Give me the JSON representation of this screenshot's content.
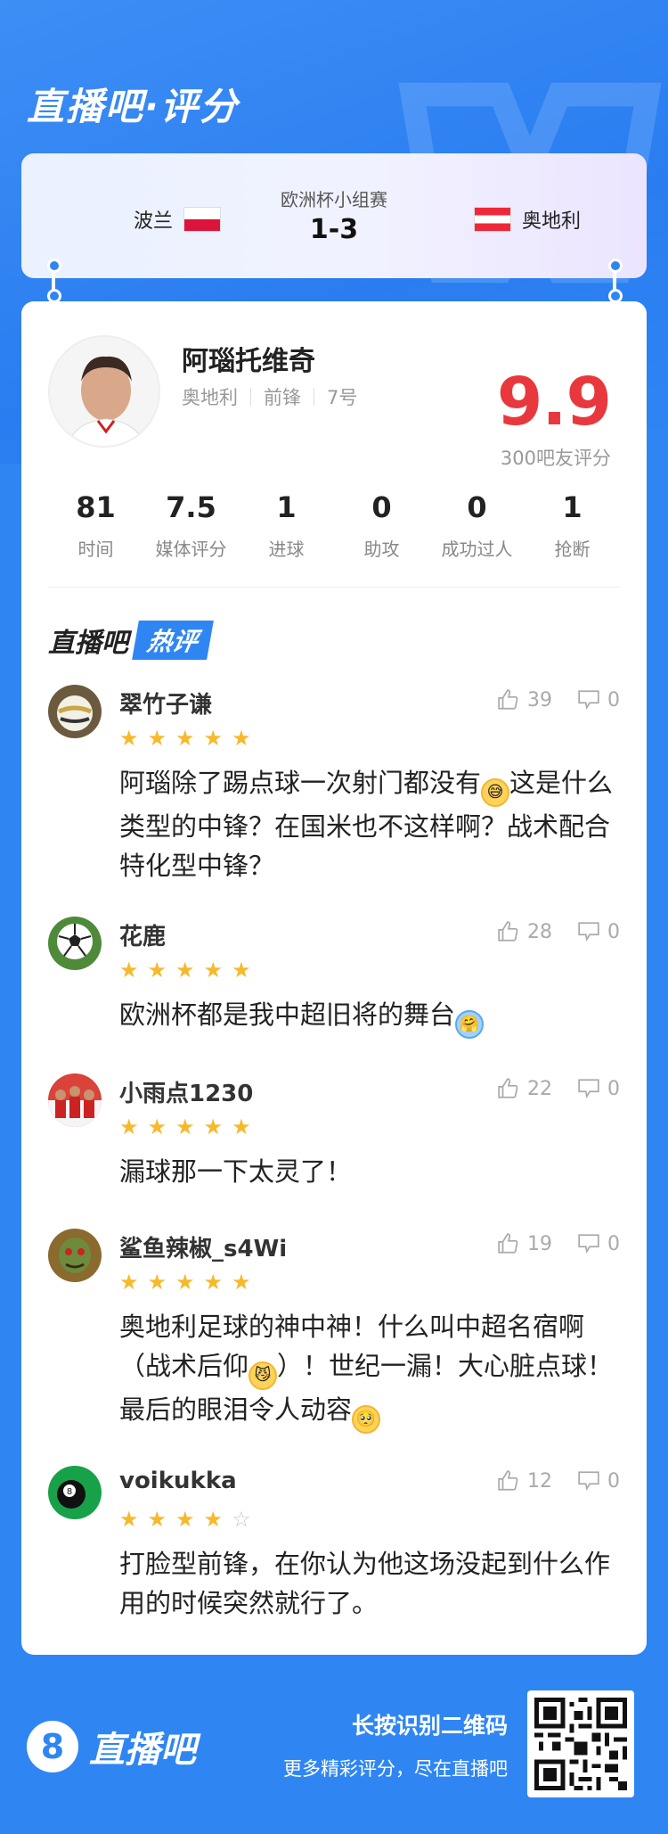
{
  "header": {
    "title": "直播吧·评分"
  },
  "match": {
    "competition": "欧洲杯小组赛",
    "score": "1-3",
    "home_team": "波兰",
    "away_team": "奥地利"
  },
  "player": {
    "name": "阿瑙托维奇",
    "team": "奥地利",
    "position": "前锋",
    "number": "7号",
    "rating": "9.9",
    "rating_label": "300吧友评分"
  },
  "stats": [
    {
      "value": "81",
      "label": "时间"
    },
    {
      "value": "7.5",
      "label": "媒体评分"
    },
    {
      "value": "1",
      "label": "进球"
    },
    {
      "value": "0",
      "label": "助攻"
    },
    {
      "value": "0",
      "label": "成功过人"
    },
    {
      "value": "1",
      "label": "抢断"
    }
  ],
  "hot": {
    "brand": "直播吧",
    "tag": "热评"
  },
  "comments": [
    {
      "user": "翠竹子谦",
      "stars": 5,
      "likes": "39",
      "dislikes": "0",
      "text_before": "阿瑙除了踢点球一次射门都没有",
      "text_after": "这是什么类型的中锋？在国米也不这样啊？战术配合特化型中锋？",
      "text_end": ""
    },
    {
      "user": "花鹿",
      "stars": 5,
      "likes": "28",
      "dislikes": "0",
      "text_before": "欧洲杯都是我中超旧将的舞台",
      "text_after": "",
      "text_end": ""
    },
    {
      "user": "小雨点1230",
      "stars": 5,
      "likes": "22",
      "dislikes": "0",
      "text_before": "漏球那一下太灵了！",
      "text_after": "",
      "text_end": ""
    },
    {
      "user": "鲨鱼辣椒_s4Wi",
      "stars": 5,
      "likes": "19",
      "dislikes": "0",
      "text_before": "奥地利足球的神中神！什么叫中超名宿啊（战术后仰",
      "text_after": "）！世纪一漏！大心脏点球！最后的眼泪令人动容",
      "text_end": ""
    },
    {
      "user": "voikukka",
      "stars": 4,
      "likes": "12",
      "dislikes": "0",
      "text_before": "打脸型前锋，在你认为他这场没起到什么作用的时候突然就行了。",
      "text_after": "",
      "text_end": ""
    }
  ],
  "footer": {
    "brand": "直播吧",
    "qr_hint": "长按识别二维码",
    "slogan": "更多精彩评分，尽在直播吧"
  },
  "colors": {
    "primary": "#2f86f3",
    "rating": "#e8383d",
    "star": "#f7b92c"
  }
}
